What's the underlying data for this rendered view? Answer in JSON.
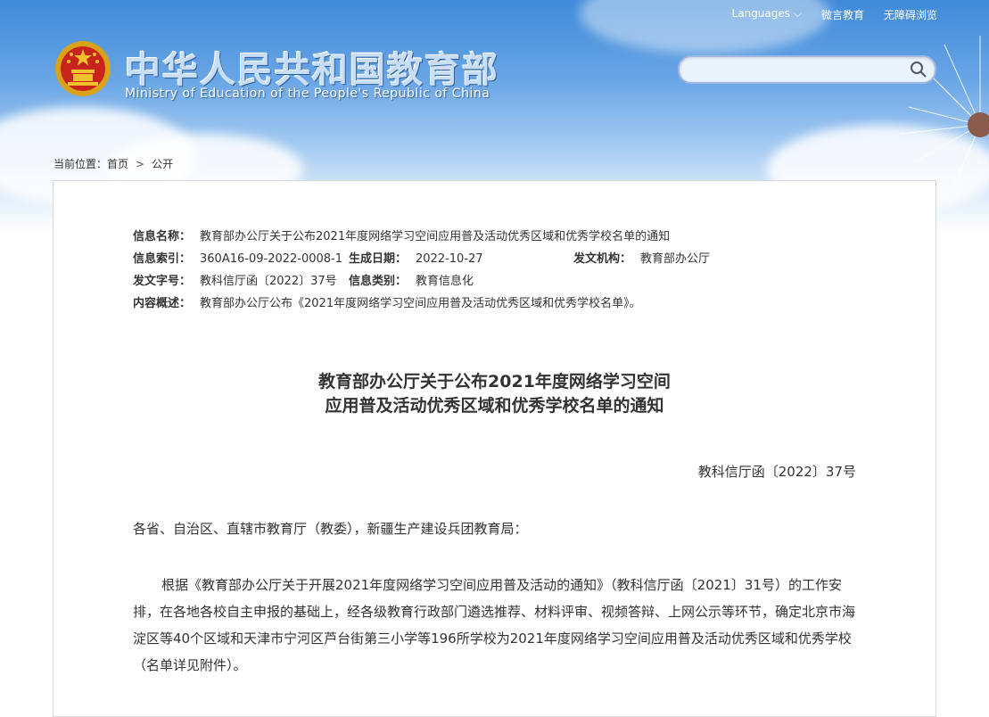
{
  "header": {
    "site_name_cn": "中华人民共和国教育部",
    "site_name_en": "Ministry of Education of the People's Republic of China",
    "links": {
      "languages": "Languages",
      "wechat": "微言教育",
      "accessibility": "无障碍浏览"
    },
    "search": {
      "placeholder": ""
    }
  },
  "breadcrumb": {
    "prefix": "当前位置：",
    "home": "首页",
    "current": "公开"
  },
  "meta": {
    "name_label": "信息名称：",
    "name_value": "教育部办公厅关于公布2021年度网络学习空间应用普及活动优秀区域和优秀学校名单的通知",
    "index_label": "信息索引：",
    "index_value": "360A16-09-2022-0008-1",
    "date_label": "生成日期：",
    "date_value": "2022-10-27",
    "issuer_label": "发文机构：",
    "issuer_value": "教育部办公厅",
    "docno_label": "发文字号：",
    "docno_value": "教科信厅函〔2022〕37号",
    "category_label": "信息类别：",
    "category_value": "教育信息化",
    "summary_label": "内容概述：",
    "summary_value": "教育部办公厅公布《2021年度网络学习空间应用普及活动优秀区域和优秀学校名单》。"
  },
  "article": {
    "title_line1": "教育部办公厅关于公布2021年度网络学习空间",
    "title_line2": "应用普及活动优秀区域和优秀学校名单的通知",
    "doc_number": "教科信厅函〔2022〕37号",
    "salutation": "各省、自治区、直辖市教育厅（教委），新疆生产建设兵团教育局：",
    "paragraph1": "根据《教育部办公厅关于开展2021年度网络学习空间应用普及活动的通知》（教科信厅函〔2021〕31号）的工作安排，在各地各校自主申报的基础上，经各级教育行政部门遴选推荐、材料评审、视频答辩、上网公示等环节，确定北京市海淀区等40个区域和天津市宁河区芦台街第三小学等196所学校为2021年度网络学习空间应用普及活动优秀区域和优秀学校（名单详见附件）。"
  },
  "icons": {
    "search": "search-icon",
    "emblem": "national-emblem-icon",
    "chevron": "chevron-down-icon"
  }
}
